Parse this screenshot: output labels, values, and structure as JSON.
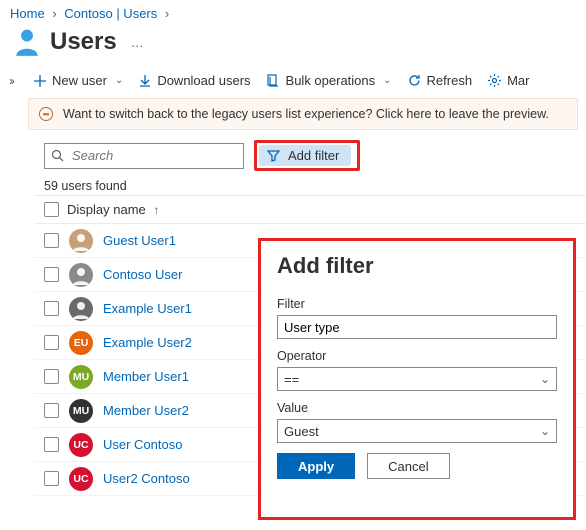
{
  "breadcrumb": {
    "items": [
      "Home",
      "Contoso | Users"
    ],
    "currentBlank": ""
  },
  "header": {
    "title": "Users",
    "more": "…"
  },
  "toolbar": {
    "newUser": "New user",
    "download": "Download users",
    "bulk": "Bulk operations",
    "refresh": "Refresh",
    "manage": "Mar"
  },
  "banner": {
    "text": "Want to switch back to the legacy users list experience? Click here to leave the preview."
  },
  "search": {
    "placeholder": "Search",
    "addFilter": "Add filter"
  },
  "grid": {
    "countText": "59 users found",
    "columnHeader": "Display name",
    "rows": [
      {
        "name": "Guest User1",
        "avatarType": "photo",
        "bg": "#c8a078"
      },
      {
        "name": "Contoso User",
        "avatarType": "photo",
        "bg": "#8a8a8a"
      },
      {
        "name": "Example User1",
        "avatarType": "photo",
        "bg": "#6a6a6a"
      },
      {
        "name": "Example User2",
        "avatarType": "init",
        "init": "EU",
        "bg": "#e8640c"
      },
      {
        "name": "Member User1",
        "avatarType": "init",
        "init": "MU",
        "bg": "#7ba825"
      },
      {
        "name": "Member User2",
        "avatarType": "init",
        "init": "MU",
        "bg": "#333333"
      },
      {
        "name": "User Contoso",
        "avatarType": "init",
        "init": "UC",
        "bg": "#d51030"
      },
      {
        "name": "User2 Contoso",
        "avatarType": "init",
        "init": "UC",
        "bg": "#d51030"
      }
    ]
  },
  "filterPanel": {
    "title": "Add filter",
    "filterLabel": "Filter",
    "filterValue": "User type",
    "operatorLabel": "Operator",
    "operatorValue": "==",
    "valueLabel": "Value",
    "valueValue": "Guest",
    "apply": "Apply",
    "cancel": "Cancel"
  }
}
